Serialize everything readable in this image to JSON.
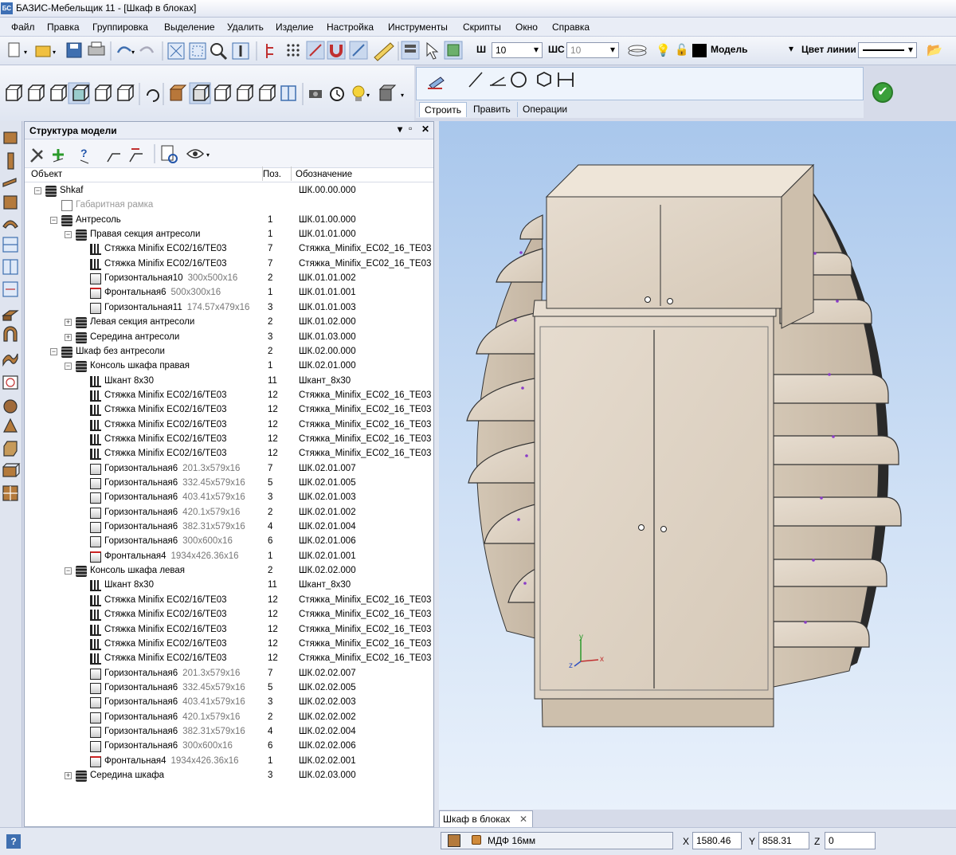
{
  "window": {
    "title": "БАЗИС-Мебельщик 11 - [Шкаф в блоках]"
  },
  "menu": [
    "Файл",
    "Правка",
    "Группировка",
    "Выделение",
    "Удалить",
    "Изделие",
    "Настройка",
    "Инструменты",
    "Скрипты",
    "Окно",
    "Справка"
  ],
  "toolbar": {
    "w_label": "Ш",
    "w_value": "10",
    "shs_label": "ШС",
    "shs_value": "10",
    "layer_value": "Модель",
    "line_color_label": "Цвет линии"
  },
  "build_panel": {
    "tabs": [
      "Строить",
      "Править",
      "Операции"
    ]
  },
  "model_panel": {
    "title": "Структура модели",
    "columns": {
      "object": "Объект",
      "pos": "Поз.",
      "designation": "Обозначение"
    },
    "rows": [
      {
        "name": "Shkaf",
        "dims": "",
        "pos": "",
        "des": "ШК.00.00.000",
        "level": 0,
        "icon": "asm",
        "exp": "−"
      },
      {
        "name": "Габаритная рамка",
        "dims": "",
        "pos": "",
        "des": "",
        "level": 1,
        "icon": "frame",
        "exp": "",
        "muted": true
      },
      {
        "name": "Антресоль",
        "dims": "",
        "pos": "1",
        "des": "ШК.01.00.000",
        "level": 1,
        "icon": "asm",
        "exp": "−"
      },
      {
        "name": "Правая секция антресоли",
        "dims": "",
        "pos": "1",
        "des": "ШК.01.01.000",
        "level": 2,
        "icon": "asm",
        "exp": "−"
      },
      {
        "name": "Стяжка Minifix EC02/16/TE03",
        "dims": "",
        "pos": "7",
        "des": "Стяжка_Minifix_EC02_16_TE03",
        "level": 3,
        "icon": "fix",
        "exp": ""
      },
      {
        "name": "Стяжка Minifix EC02/16/TE03",
        "dims": "",
        "pos": "7",
        "des": "Стяжка_Minifix_EC02_16_TE03",
        "level": 3,
        "icon": "fix",
        "exp": ""
      },
      {
        "name": "Горизонтальная10",
        "dims": "300x500x16",
        "pos": "2",
        "des": "ШК.01.01.002",
        "level": 3,
        "icon": "part",
        "exp": ""
      },
      {
        "name": "Фронтальная6",
        "dims": "500x300x16",
        "pos": "1",
        "des": "ШК.01.01.001",
        "level": 3,
        "icon": "part",
        "exp": ""
      },
      {
        "name": "Горизонтальная11",
        "dims": "174.57x479x16",
        "pos": "3",
        "des": "ШК.01.01.003",
        "level": 3,
        "icon": "part",
        "exp": ""
      },
      {
        "name": "Левая секция антресоли",
        "dims": "",
        "pos": "2",
        "des": "ШК.01.02.000",
        "level": 2,
        "icon": "asm",
        "exp": "+"
      },
      {
        "name": "Середина антресоли",
        "dims": "",
        "pos": "3",
        "des": "ШК.01.03.000",
        "level": 2,
        "icon": "asm",
        "exp": "+"
      },
      {
        "name": "Шкаф без антресоли",
        "dims": "",
        "pos": "2",
        "des": "ШК.02.00.000",
        "level": 1,
        "icon": "asm",
        "exp": "−"
      },
      {
        "name": "Консоль шкафа правая",
        "dims": "",
        "pos": "1",
        "des": "ШК.02.01.000",
        "level": 2,
        "icon": "asm",
        "exp": "−"
      },
      {
        "name": "Шкант 8x30",
        "dims": "",
        "pos": "11",
        "des": "Шкант_8x30",
        "level": 3,
        "icon": "fix",
        "exp": ""
      },
      {
        "name": "Стяжка Minifix EC02/16/TE03",
        "dims": "",
        "pos": "12",
        "des": "Стяжка_Minifix_EC02_16_TE03",
        "level": 3,
        "icon": "fix",
        "exp": ""
      },
      {
        "name": "Стяжка Minifix EC02/16/TE03",
        "dims": "",
        "pos": "12",
        "des": "Стяжка_Minifix_EC02_16_TE03",
        "level": 3,
        "icon": "fix",
        "exp": ""
      },
      {
        "name": "Стяжка Minifix EC02/16/TE03",
        "dims": "",
        "pos": "12",
        "des": "Стяжка_Minifix_EC02_16_TE03",
        "level": 3,
        "icon": "fix",
        "exp": ""
      },
      {
        "name": "Стяжка Minifix EC02/16/TE03",
        "dims": "",
        "pos": "12",
        "des": "Стяжка_Minifix_EC02_16_TE03",
        "level": 3,
        "icon": "fix",
        "exp": ""
      },
      {
        "name": "Стяжка Minifix EC02/16/TE03",
        "dims": "",
        "pos": "12",
        "des": "Стяжка_Minifix_EC02_16_TE03",
        "level": 3,
        "icon": "fix",
        "exp": ""
      },
      {
        "name": "Горизонтальная6",
        "dims": "201.3x579x16",
        "pos": "7",
        "des": "ШК.02.01.007",
        "level": 3,
        "icon": "part",
        "exp": ""
      },
      {
        "name": "Горизонтальная6",
        "dims": "332.45x579x16",
        "pos": "5",
        "des": "ШК.02.01.005",
        "level": 3,
        "icon": "part",
        "exp": ""
      },
      {
        "name": "Горизонтальная6",
        "dims": "403.41x579x16",
        "pos": "3",
        "des": "ШК.02.01.003",
        "level": 3,
        "icon": "part",
        "exp": ""
      },
      {
        "name": "Горизонтальная6",
        "dims": "420.1x579x16",
        "pos": "2",
        "des": "ШК.02.01.002",
        "level": 3,
        "icon": "part",
        "exp": ""
      },
      {
        "name": "Горизонтальная6",
        "dims": "382.31x579x16",
        "pos": "4",
        "des": "ШК.02.01.004",
        "level": 3,
        "icon": "part",
        "exp": ""
      },
      {
        "name": "Горизонтальная6",
        "dims": "300x600x16",
        "pos": "6",
        "des": "ШК.02.01.006",
        "level": 3,
        "icon": "part",
        "exp": ""
      },
      {
        "name": "Фронтальная4",
        "dims": "1934x426.36x16",
        "pos": "1",
        "des": "ШК.02.01.001",
        "level": 3,
        "icon": "part",
        "exp": ""
      },
      {
        "name": "Консоль шкафа левая",
        "dims": "",
        "pos": "2",
        "des": "ШК.02.02.000",
        "level": 2,
        "icon": "asm",
        "exp": "−"
      },
      {
        "name": "Шкант 8x30",
        "dims": "",
        "pos": "11",
        "des": "Шкант_8x30",
        "level": 3,
        "icon": "fix",
        "exp": ""
      },
      {
        "name": "Стяжка Minifix EC02/16/TE03",
        "dims": "",
        "pos": "12",
        "des": "Стяжка_Minifix_EC02_16_TE03",
        "level": 3,
        "icon": "fix",
        "exp": ""
      },
      {
        "name": "Стяжка Minifix EC02/16/TE03",
        "dims": "",
        "pos": "12",
        "des": "Стяжка_Minifix_EC02_16_TE03",
        "level": 3,
        "icon": "fix",
        "exp": ""
      },
      {
        "name": "Стяжка Minifix EC02/16/TE03",
        "dims": "",
        "pos": "12",
        "des": "Стяжка_Minifix_EC02_16_TE03",
        "level": 3,
        "icon": "fix",
        "exp": ""
      },
      {
        "name": "Стяжка Minifix EC02/16/TE03",
        "dims": "",
        "pos": "12",
        "des": "Стяжка_Minifix_EC02_16_TE03",
        "level": 3,
        "icon": "fix",
        "exp": ""
      },
      {
        "name": "Стяжка Minifix EC02/16/TE03",
        "dims": "",
        "pos": "12",
        "des": "Стяжка_Minifix_EC02_16_TE03",
        "level": 3,
        "icon": "fix",
        "exp": ""
      },
      {
        "name": "Горизонтальная6",
        "dims": "201.3x579x16",
        "pos": "7",
        "des": "ШК.02.02.007",
        "level": 3,
        "icon": "part",
        "exp": ""
      },
      {
        "name": "Горизонтальная6",
        "dims": "332.45x579x16",
        "pos": "5",
        "des": "ШК.02.02.005",
        "level": 3,
        "icon": "part",
        "exp": ""
      },
      {
        "name": "Горизонтальная6",
        "dims": "403.41x579x16",
        "pos": "3",
        "des": "ШК.02.02.003",
        "level": 3,
        "icon": "part",
        "exp": ""
      },
      {
        "name": "Горизонтальная6",
        "dims": "420.1x579x16",
        "pos": "2",
        "des": "ШК.02.02.002",
        "level": 3,
        "icon": "part",
        "exp": ""
      },
      {
        "name": "Горизонтальная6",
        "dims": "382.31x579x16",
        "pos": "4",
        "des": "ШК.02.02.004",
        "level": 3,
        "icon": "part",
        "exp": ""
      },
      {
        "name": "Горизонтальная6",
        "dims": "300x600x16",
        "pos": "6",
        "des": "ШК.02.02.006",
        "level": 3,
        "icon": "part",
        "exp": ""
      },
      {
        "name": "Фронтальная4",
        "dims": "1934x426.36x16",
        "pos": "1",
        "des": "ШК.02.02.001",
        "level": 3,
        "icon": "part",
        "exp": ""
      },
      {
        "name": "Середина шкафа",
        "dims": "",
        "pos": "3",
        "des": "ШК.02.03.000",
        "level": 2,
        "icon": "asm",
        "exp": "+"
      }
    ]
  },
  "viewport": {
    "tab_label": "Шкаф в блоках",
    "axes": {
      "x": "x",
      "y": "y",
      "z": "z"
    }
  },
  "statusbar": {
    "material": "МДФ 16мм",
    "x_label": "X",
    "x_value": "1580.46",
    "y_label": "Y",
    "y_value": "858.31",
    "z_label": "Z",
    "z_value": "0"
  }
}
